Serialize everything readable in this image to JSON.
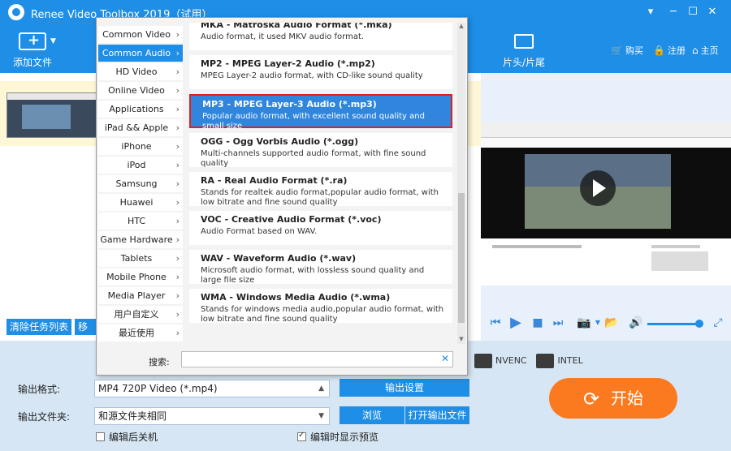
{
  "window": {
    "title": "Renee Video Toolbox 2019（试用）",
    "min": "▾",
    "minimize": "─",
    "maximize": "☐",
    "close": "✕"
  },
  "toolbar": {
    "add_file": "添加文件",
    "head_tail": "片头/片尾",
    "buy": "购买",
    "register": "注册",
    "home": "主页"
  },
  "left_buttons": {
    "clear_tasks": "清除任务列表",
    "move": "移"
  },
  "categories": [
    {
      "label": "Common Video",
      "selected": false
    },
    {
      "label": "Common Audio",
      "selected": true
    },
    {
      "label": "HD Video",
      "selected": false
    },
    {
      "label": "Online Video",
      "selected": false
    },
    {
      "label": "Applications",
      "selected": false
    },
    {
      "label": "iPad && Apple TV",
      "selected": false
    },
    {
      "label": "iPhone",
      "selected": false
    },
    {
      "label": "iPod",
      "selected": false
    },
    {
      "label": "Samsung",
      "selected": false
    },
    {
      "label": "Huawei",
      "selected": false
    },
    {
      "label": "HTC",
      "selected": false
    },
    {
      "label": "Game Hardware",
      "selected": false
    },
    {
      "label": "Tablets",
      "selected": false
    },
    {
      "label": "Mobile Phone",
      "selected": false
    },
    {
      "label": "Media Player",
      "selected": false
    },
    {
      "label": "用户自定义",
      "selected": false
    },
    {
      "label": "最近使用",
      "selected": false
    }
  ],
  "formats": [
    {
      "name": "MKA - Matroska Audio Format (*.mka)",
      "desc": "Audio format, it used MKV audio format.",
      "selected": false
    },
    {
      "name": "MP2 - MPEG Layer-2 Audio (*.mp2)",
      "desc": "MPEG Layer-2 audio format, with CD-like sound quality",
      "selected": false
    },
    {
      "name": "MP3 - MPEG Layer-3 Audio (*.mp3)",
      "desc": "Popular audio format, with excellent sound quality and small size",
      "selected": true
    },
    {
      "name": "OGG - Ogg Vorbis Audio (*.ogg)",
      "desc": "Multi-channels supported audio format, with fine sound quality",
      "selected": false
    },
    {
      "name": "RA - Real Audio Format (*.ra)",
      "desc": "Stands for realtek audio format,popular audio format, with low bitrate and fine sound quality",
      "selected": false
    },
    {
      "name": "VOC - Creative Audio Format (*.voc)",
      "desc": "Audio Format based on WAV.",
      "selected": false
    },
    {
      "name": "WAV - Waveform Audio (*.wav)",
      "desc": "Microsoft audio format, with lossless sound quality and large file size",
      "selected": false
    },
    {
      "name": "WMA - Windows Media Audio (*.wma)",
      "desc": "Stands for windows media audio,popular audio format, with low bitrate and fine sound quality",
      "selected": false
    }
  ],
  "search": {
    "label": "搜索:",
    "value": "",
    "clear": "✕"
  },
  "output": {
    "format_label": "输出格式:",
    "format_value": "MP4 720P Video (*.mp4)",
    "settings_button": "输出设置",
    "folder_label": "输出文件夹:",
    "folder_value": "和源文件夹相同",
    "browse_button": "浏览",
    "open_folder_button": "打开输出文件",
    "shutdown_label": "编辑后关机",
    "shutdown_checked": false,
    "preview_label": "编辑时显示预览",
    "preview_checked": true
  },
  "badges": {
    "nvenc": "NVENC",
    "intel": "INTEL"
  },
  "start_button": "开始",
  "colors": {
    "accent": "#1e8ee6",
    "start": "#fb7a1f",
    "selected_border": "#e02020"
  }
}
